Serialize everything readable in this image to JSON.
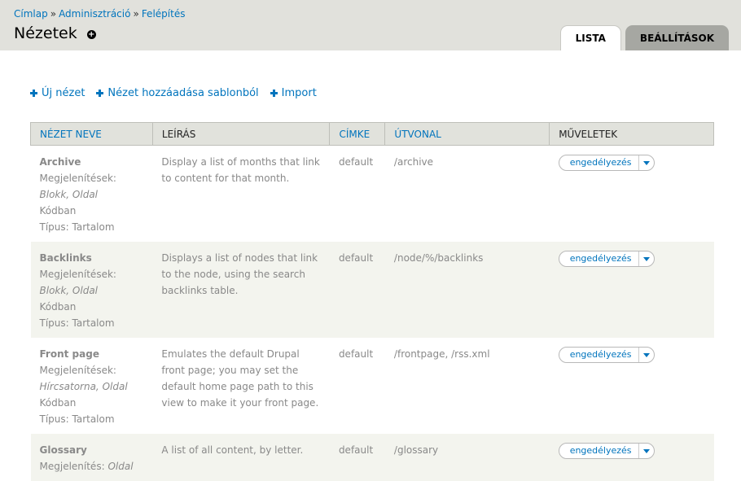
{
  "breadcrumb": [
    {
      "label": "Címlap"
    },
    {
      "label": "Adminisztráció"
    },
    {
      "label": "Felépítés"
    }
  ],
  "breadcrumb_separator": "»",
  "page_title": "Nézetek",
  "tabs": [
    {
      "label": "LISTA",
      "active": true
    },
    {
      "label": "BEÁLLÍTÁSOK",
      "active": false
    }
  ],
  "actions": [
    {
      "label": "Új nézet"
    },
    {
      "label": "Nézet hozzáadása sablonból"
    },
    {
      "label": "Import"
    }
  ],
  "table": {
    "headers": {
      "name": "NÉZET NEVE",
      "description": "LEÍRÁS",
      "tag": "CÍMKE",
      "path": "ÚTVONAL",
      "operations": "MŰVELETEK"
    },
    "rows": [
      {
        "name": "Archive",
        "displays_label": "Megjelenítések:",
        "displays": "Blokk, Oldal",
        "storage": "Kódban",
        "type": "Típus: Tartalom",
        "description": "Display a list of months that link to content for that month.",
        "tag": "default",
        "path": "/archive",
        "operation": "engedélyezés"
      },
      {
        "name": "Backlinks",
        "displays_label": "Megjelenítések:",
        "displays": "Blokk, Oldal",
        "storage": "Kódban",
        "type": "Típus: Tartalom",
        "description": "Displays a list of nodes that link to the node, using the search backlinks table.",
        "tag": "default",
        "path": "/node/%/backlinks",
        "operation": "engedélyezés"
      },
      {
        "name": "Front page",
        "displays_label": "Megjelenítések:",
        "displays": "Hírcsatorna, Oldal",
        "storage": "Kódban",
        "type": "Típus: Tartalom",
        "description": "Emulates the default Drupal front page; you may set the default home page path to this view to make it your front page.",
        "tag": "default",
        "path": "/frontpage, /rss.xml",
        "operation": "engedélyezés"
      },
      {
        "name": "Glossary",
        "displays_label": "Megjelenítés:",
        "displays": "Oldal",
        "storage": "",
        "type": "",
        "description": "A list of all content, by letter.",
        "tag": "default",
        "path": "/glossary",
        "operation": "engedélyezés"
      }
    ]
  },
  "colors": {
    "link": "#0074bd",
    "header_bg": "#e1e1dc",
    "even_row_bg": "#f3f4ee"
  },
  "icons": {
    "title_add": "plus-circle-icon",
    "action": "plus-icon",
    "dropdown": "triangle-down-icon"
  }
}
